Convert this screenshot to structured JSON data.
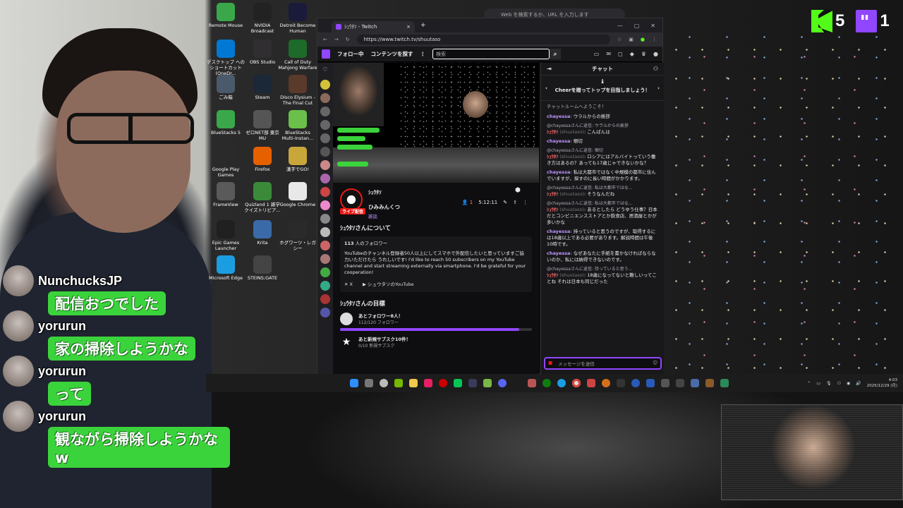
{
  "overlay": {
    "kick_count": "5",
    "twitch_count": "1"
  },
  "chrome_top": {
    "search_placeholder": "Web を検索するか、URL を入力します"
  },
  "desktop_icons": [
    {
      "label": "Remote Mouse",
      "icon": "remote-mouse-icon",
      "color": "#3aa84a"
    },
    {
      "label": "NVIDIA Broadcast",
      "icon": "nvidia-icon",
      "color": "#222"
    },
    {
      "label": "Detroit Become Human",
      "icon": "detroit-icon",
      "color": "#1a1a3a"
    },
    {
      "label": "デスクトップ へのショートカット (OneDr...",
      "icon": "onedrive-icon",
      "color": "#0078d4"
    },
    {
      "label": "OBS Studio",
      "icon": "obs-icon",
      "color": "#302e31"
    },
    {
      "label": "Call of Duty Mahjong Warfare",
      "icon": "mahjong-icon",
      "color": "#1e6a2a"
    },
    {
      "label": "ごみ箱",
      "icon": "recycle-bin-icon",
      "color": "#4a5a6a"
    },
    {
      "label": "Steam",
      "icon": "steam-icon",
      "color": "#1b2838"
    },
    {
      "label": "Disco Elysium - The Final Cut",
      "icon": "disco-icon",
      "color": "#5a3a2a"
    },
    {
      "label": "BlueStacks 5",
      "icon": "bluestacks-icon",
      "color": "#3aa84a"
    },
    {
      "label": "ゼロNET部 東京MU",
      "icon": "zeronet-icon",
      "color": "#555"
    },
    {
      "label": "BlueStacks Multi-Instan...",
      "icon": "bluestacks-multi-icon",
      "color": "#6ac04a"
    },
    {
      "label": "Google Play Games",
      "icon": "play-games-icon",
      "color": "#2a2a2a"
    },
    {
      "label": "Firefox",
      "icon": "firefox-icon",
      "color": "#e66000"
    },
    {
      "label": "漢字でGO!",
      "icon": "kanji-go-icon",
      "color": "#c9a63a"
    },
    {
      "label": "FrameView",
      "icon": "frameview-icon",
      "color": "#5a5a5a"
    },
    {
      "label": "Quizland 1 雑学クイズトリビア...",
      "icon": "quizland-icon",
      "color": "#3a8a3a"
    },
    {
      "label": "Google Chrome",
      "icon": "chrome-icon",
      "color": "#e8e8e8"
    },
    {
      "label": "Epic Games Launcher",
      "icon": "epic-icon",
      "color": "#202020"
    },
    {
      "label": "Krita",
      "icon": "krita-icon",
      "color": "#3a6aa8"
    },
    {
      "label": "ホグワーツ・レガシー",
      "icon": "hogwarts-icon",
      "color": "#2a2a2a"
    },
    {
      "label": "Microsoft Edge",
      "icon": "edge-icon",
      "color": "#1b9de2"
    },
    {
      "label": "STEINS;GATE",
      "icon": "steinsgate-icon",
      "color": "#444"
    }
  ],
  "browser": {
    "tab_title": "ｼｭｳﾀｿ - Twitch",
    "url": "https://www.twitch.tv/shuutaso"
  },
  "twitch_nav": {
    "following": "フォロー中",
    "browse": "コンテンツを探す",
    "more": "⋮",
    "search_placeholder": "検索"
  },
  "channel": {
    "name": "ｼｭｳﾀｿ",
    "live_badge": "ライブ配信",
    "title": "ひみみんくつ",
    "category": "雑談",
    "viewers": "1",
    "uptime": "5:12:11"
  },
  "about": {
    "heading": "ｼｭｳﾀｿさんについて",
    "followers_count": "113",
    "followers_label": "人のフォロワー",
    "description": "YouTubeのチャンネル登録者50人以上にしてスマホで外配信したいと思っていますご協力いただけたら うれしいです! I'd like to reach 50 subscribers on my YouTube channel and start streaming externally via smartphone. I'd be grateful for your cooperation!",
    "link_x": "X",
    "link_youtube": "シュウタソのYouTube"
  },
  "goals": {
    "heading": "ｼｭｳﾀｿさんの目標",
    "items": [
      {
        "title": "あとフォロワー8人！",
        "sub": "112/120 フォロワー",
        "progress": 0.933
      },
      {
        "title": "あと新規サブスク10件！",
        "sub": "0/10 新規サブスク",
        "progress": 0.0
      }
    ]
  },
  "chat": {
    "header": "チャット",
    "cheer_banner": "Cheerを贈ってトップを目指しましょう！",
    "welcome": "チャットルームへようこそ！",
    "messages": [
      {
        "user": "chayessa",
        "text": "ウラルからの挨拶"
      },
      {
        "reply": "@chayessaさんに返信: ウラルからの挨拶",
        "user": "ｼｭｳﾀｿ",
        "handle": "(shuutaso)",
        "text": "こんばんは"
      },
      {
        "user": "chayessa",
        "text": "梱切"
      },
      {
        "reply": "@chayessaさんに返信: 梱切",
        "user": "ｼｭｳﾀｿ",
        "handle": "(shuutaso)",
        "text": "ロシアにはアルバイトっていう働き方はあるの？あっても17歳じゃできないかな？"
      },
      {
        "user": "chayessa",
        "text": "私は大都市ではなく中規模の都市に住んでいますが、探すのに長い時間がかかります。"
      },
      {
        "reply": "@chayessaさんに返信: 私は大都市ではな...",
        "user": "ｼｭｳﾀｿ",
        "handle": "(shuutaso)",
        "text": "そうなんだね"
      },
      {
        "reply": "@chayessaさんに返信: 私は大都市ではな...",
        "user": "ｼｭｳﾀｿ",
        "handle": "(shuutaso)",
        "text": "あるとしたら どうゆう仕事？日本だとコンビニエンスストアとか飲食店、居酒屋とかが多いかな"
      },
      {
        "user": "chayessa",
        "text": "持っていると思うのですが、取得するには18歳以上である必要があります。解説時間は午後10時です。"
      },
      {
        "user": "chayessa",
        "text": "なぜあなたに手紙を書かなければならないのか、私には納得できないのです。"
      },
      {
        "reply": "@chayessaさんに返信: 持っていると思う...",
        "user": "ｼｭｳﾀｿ",
        "handle": "(shuutaso)",
        "text": "18歳になってないと難しいってことね それは日本も同じだった"
      }
    ],
    "input_placeholder": "メッセージを送信"
  },
  "taskbar": {
    "time": "4:03",
    "date": "2025/12/29 (月)"
  },
  "overlay_chat": [
    {
      "name": "NunchucksJP",
      "messages": [
        "配信おつでした"
      ]
    },
    {
      "name": "yorurun",
      "messages": [
        "家の掃除しようかな"
      ]
    },
    {
      "name": "yorurun",
      "messages": [
        "って"
      ]
    },
    {
      "name": "yorurun",
      "messages": [
        "観ながら掃除しようかな",
        "w"
      ]
    }
  ]
}
